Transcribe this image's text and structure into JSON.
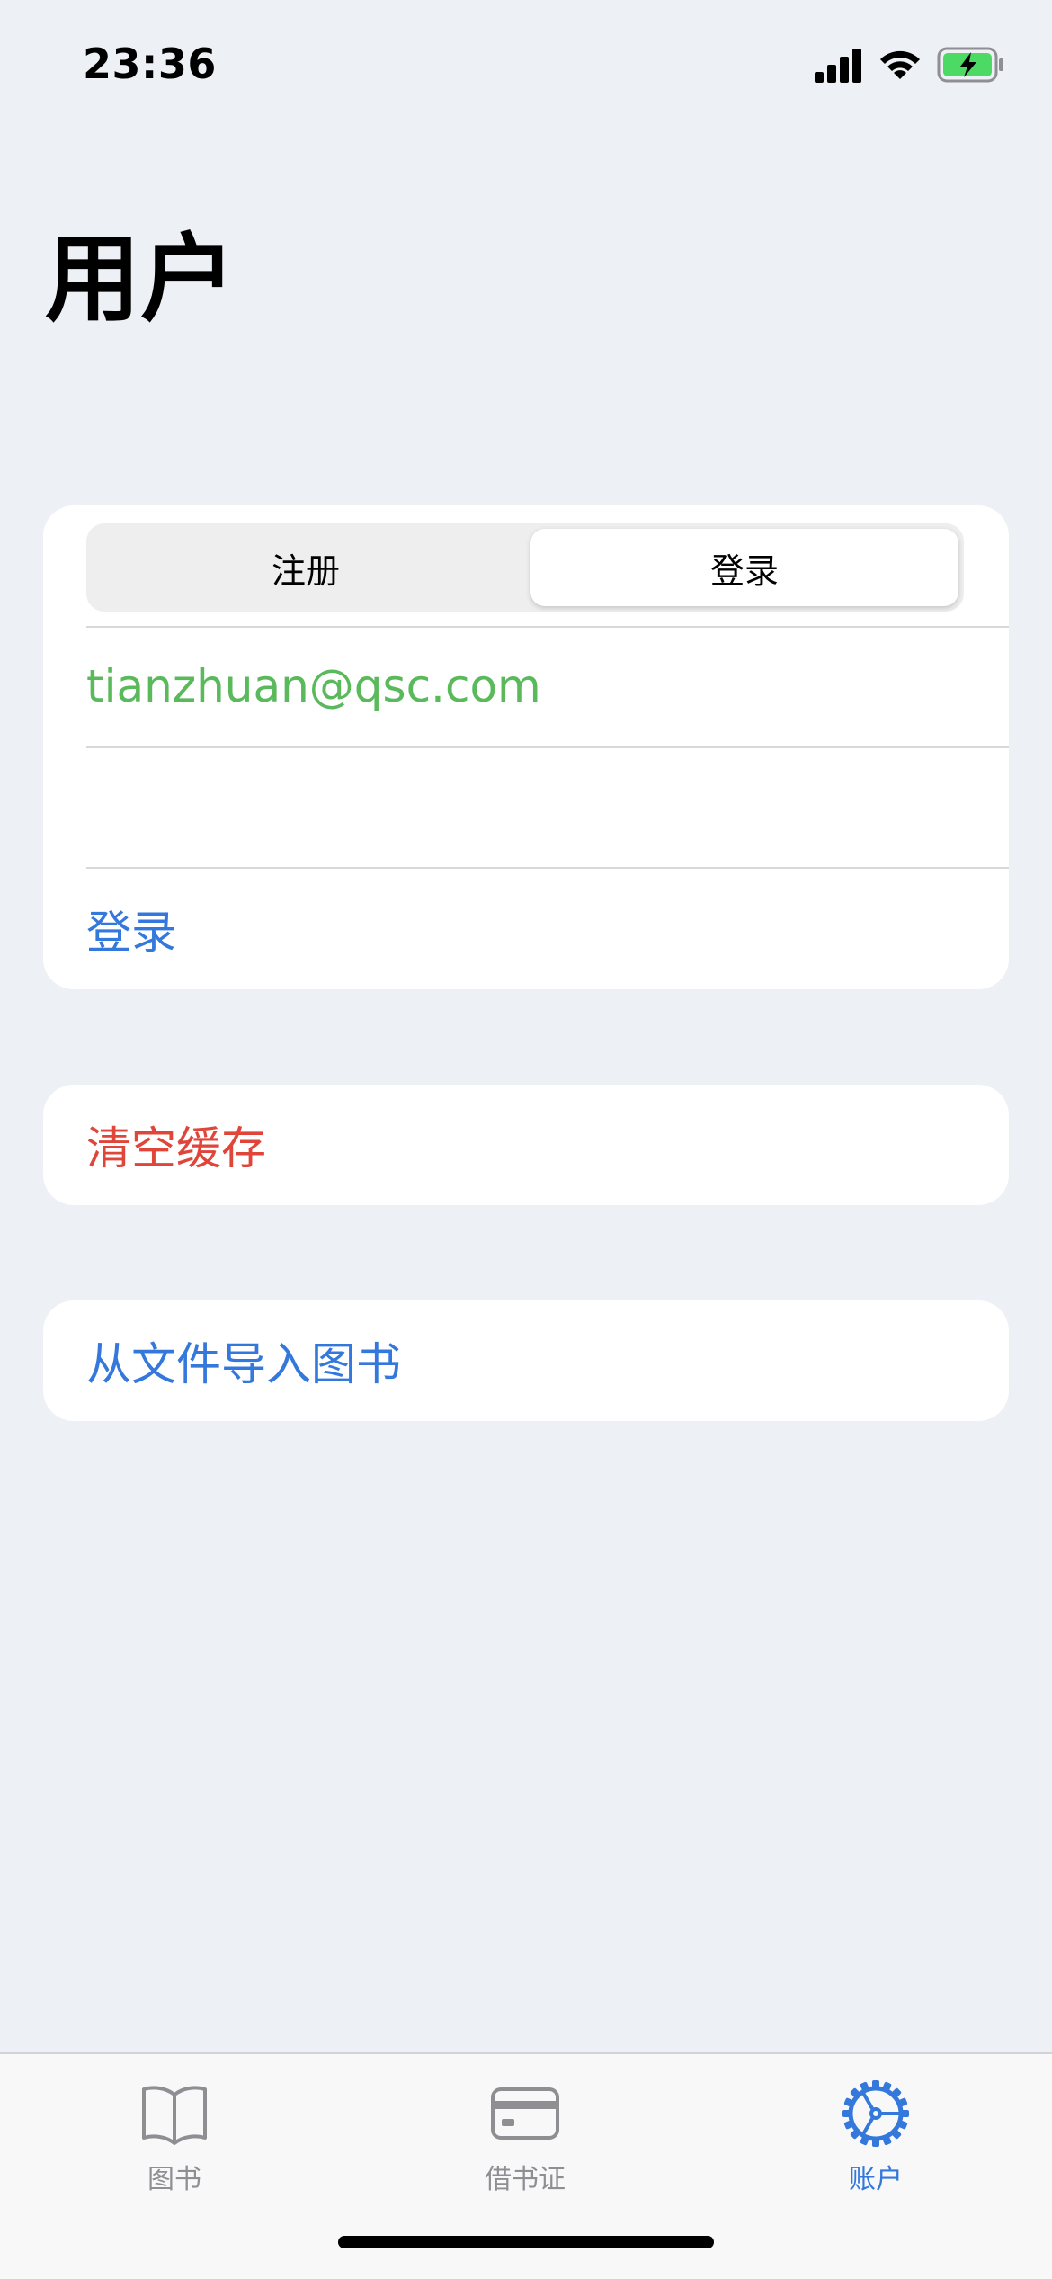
{
  "status_bar": {
    "time": "23:36",
    "icons": [
      "cellular-signal-icon",
      "wifi-icon",
      "battery-charging-icon"
    ]
  },
  "header": {
    "title": "用户"
  },
  "login_card": {
    "segments": [
      {
        "label": "注册",
        "selected": false
      },
      {
        "label": "登录",
        "selected": true
      }
    ],
    "email_value": "tianzhuan@qsc.com",
    "password_value": "",
    "login_button": "登录"
  },
  "cache_card": {
    "clear_cache_label": "清空缓存"
  },
  "import_card": {
    "import_label": "从文件导入图书"
  },
  "tab_bar": {
    "items": [
      {
        "label": "图书",
        "icon": "book-icon",
        "active": false
      },
      {
        "label": "借书证",
        "icon": "card-icon",
        "active": false
      },
      {
        "label": "账户",
        "icon": "gear-icon",
        "active": true
      }
    ]
  },
  "colors": {
    "accent_blue": "#3478dc",
    "destructive_red": "#e0453a",
    "email_green": "#59b95b",
    "background": "#edf0f5"
  }
}
